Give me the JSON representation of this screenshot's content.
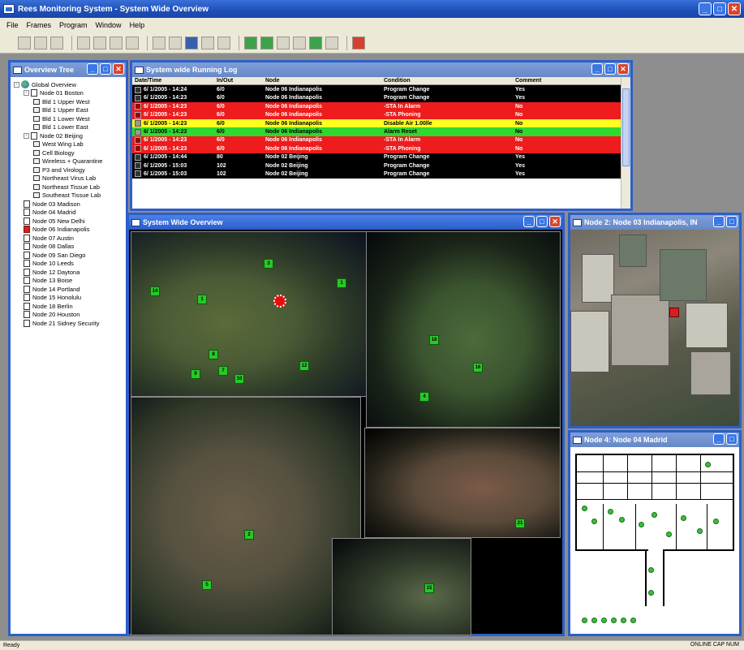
{
  "app": {
    "title": "Rees Monitoring System - System Wide Overview"
  },
  "menu": [
    "File",
    "Frames",
    "Program",
    "Window",
    "Help"
  ],
  "overview_tree": {
    "title": "Overview Tree",
    "items": [
      {
        "label": "Global Overview",
        "level": 0,
        "type": "globe",
        "expander": "-"
      },
      {
        "label": "Node 01 Boston",
        "level": 1,
        "type": "node",
        "expander": "-"
      },
      {
        "label": "Bld 1 Upper West",
        "level": 2,
        "type": "sub"
      },
      {
        "label": "Bld 1 Upper East",
        "level": 2,
        "type": "sub"
      },
      {
        "label": "Bld 1 Lower West",
        "level": 2,
        "type": "sub"
      },
      {
        "label": "Bld 1 Lower East",
        "level": 2,
        "type": "sub"
      },
      {
        "label": "Node 02 Beijing",
        "level": 1,
        "type": "node",
        "expander": "-"
      },
      {
        "label": "West Wing Lab",
        "level": 2,
        "type": "sub"
      },
      {
        "label": "Cell Biology",
        "level": 2,
        "type": "sub"
      },
      {
        "label": "Wireless + Quarantine",
        "level": 2,
        "type": "sub"
      },
      {
        "label": "P3 and Virology",
        "level": 2,
        "type": "sub"
      },
      {
        "label": "Northeast Virus Lab",
        "level": 2,
        "type": "sub"
      },
      {
        "label": "Northeast Tissue Lab",
        "level": 2,
        "type": "sub"
      },
      {
        "label": "Southeast Tissue Lab",
        "level": 2,
        "type": "sub"
      },
      {
        "label": "Node 03 Madison",
        "level": 1,
        "type": "node"
      },
      {
        "label": "Node 04 Madrid",
        "level": 1,
        "type": "node"
      },
      {
        "label": "Node 05 New Delhi",
        "level": 1,
        "type": "node"
      },
      {
        "label": "Node 06 Indianapolis",
        "level": 1,
        "type": "alarm"
      },
      {
        "label": "Node 07 Austin",
        "level": 1,
        "type": "node"
      },
      {
        "label": "Node 08 Dallas",
        "level": 1,
        "type": "node"
      },
      {
        "label": "Node 09 San Diego",
        "level": 1,
        "type": "node"
      },
      {
        "label": "Node 10 Leeds",
        "level": 1,
        "type": "node"
      },
      {
        "label": "Node 12 Daytona",
        "level": 1,
        "type": "node"
      },
      {
        "label": "Node 13 Boise",
        "level": 1,
        "type": "node"
      },
      {
        "label": "Node 14 Portland",
        "level": 1,
        "type": "node"
      },
      {
        "label": "Node 15 Honolulu",
        "level": 1,
        "type": "node"
      },
      {
        "label": "Node 18 Berlin",
        "level": 1,
        "type": "node"
      },
      {
        "label": "Node 20 Houston",
        "level": 1,
        "type": "node"
      },
      {
        "label": "Node 21 Sidney Security",
        "level": 1,
        "type": "node"
      }
    ]
  },
  "running_log": {
    "title": "System wide Running Log",
    "columns": [
      "Date/Time",
      "In/Out",
      "Node",
      "Condition",
      "Comment"
    ],
    "rows": [
      {
        "time": "6/ 1/2005 - 14:24",
        "io": "6/0",
        "node": "Node 06 Indianapolis",
        "condition": "Program Change",
        "comment": "Yes",
        "color": "black"
      },
      {
        "time": "6/ 1/2005 - 14:23",
        "io": "6/0",
        "node": "Node 06 Indianapolis",
        "condition": "Program Change",
        "comment": "Yes",
        "color": "black"
      },
      {
        "time": "6/ 1/2005 - 14:23",
        "io": "6/0",
        "node": "Node 06 Indianapolis",
        "condition": "-STA In Alarm",
        "comment": "No",
        "color": "red"
      },
      {
        "time": "6/ 1/2005 - 14:23",
        "io": "6/0",
        "node": "Node 06 Indianapolis",
        "condition": "-STA Phoning",
        "comment": "No",
        "color": "red"
      },
      {
        "time": "6/ 1/2005 - 14:23",
        "io": "6/0",
        "node": "Node 06 Indianapolis",
        "condition": "Disable Air 1.00lle",
        "comment": "No",
        "color": "yellow"
      },
      {
        "time": "6/ 1/2005 - 14:23",
        "io": "6/0",
        "node": "Node 06 Indianapolis",
        "condition": "Alarm Reset",
        "comment": "No",
        "color": "green"
      },
      {
        "time": "6/ 1/2005 - 14:23",
        "io": "6/0",
        "node": "Node 06 Indianapolis",
        "condition": "-STA In Alarm",
        "comment": "No",
        "color": "red"
      },
      {
        "time": "6/ 1/2005 - 14:23",
        "io": "6/0",
        "node": "Node 06 Indianapolis",
        "condition": "-STA Phoning",
        "comment": "No",
        "color": "red"
      },
      {
        "time": "6/ 1/2005 - 14:44",
        "io": "80",
        "node": "Node 02 Beijing",
        "condition": "Program Change",
        "comment": "Yes",
        "color": "black"
      },
      {
        "time": "6/ 1/2005 - 15:03",
        "io": "102",
        "node": "Node 02 Beijing",
        "condition": "Program Change",
        "comment": "Yes",
        "color": "black"
      },
      {
        "time": "6/ 1/2005 - 15:03",
        "io": "102",
        "node": "Node 02 Beijing",
        "condition": "Program Change",
        "comment": "Yes",
        "color": "black"
      }
    ]
  },
  "overview": {
    "title": "System Wide Overview",
    "markers": [
      {
        "label": "3"
      },
      {
        "label": "14"
      },
      {
        "label": "1"
      },
      {
        "label": "1"
      },
      {
        "label": "8"
      },
      {
        "label": "9"
      },
      {
        "label": "7"
      },
      {
        "label": "10"
      },
      {
        "label": "12"
      },
      {
        "label": "18"
      },
      {
        "label": "16"
      },
      {
        "label": "4"
      },
      {
        "label": "2"
      },
      {
        "label": "5"
      },
      {
        "label": "21"
      },
      {
        "label": "15"
      }
    ]
  },
  "node_photo": {
    "title": "Node 2: Node 03 Indianapolis, IN"
  },
  "node_floor": {
    "title": "Node 4: Node 04 Madrid"
  },
  "status": {
    "left": "Ready",
    "right": "ONLINE CAP NUM"
  },
  "colors": {
    "title_blue": "#2d5fc8",
    "alarm_red": "#ee1c1c",
    "ok_green": "#30d830",
    "warn_yellow": "#ffff20"
  }
}
